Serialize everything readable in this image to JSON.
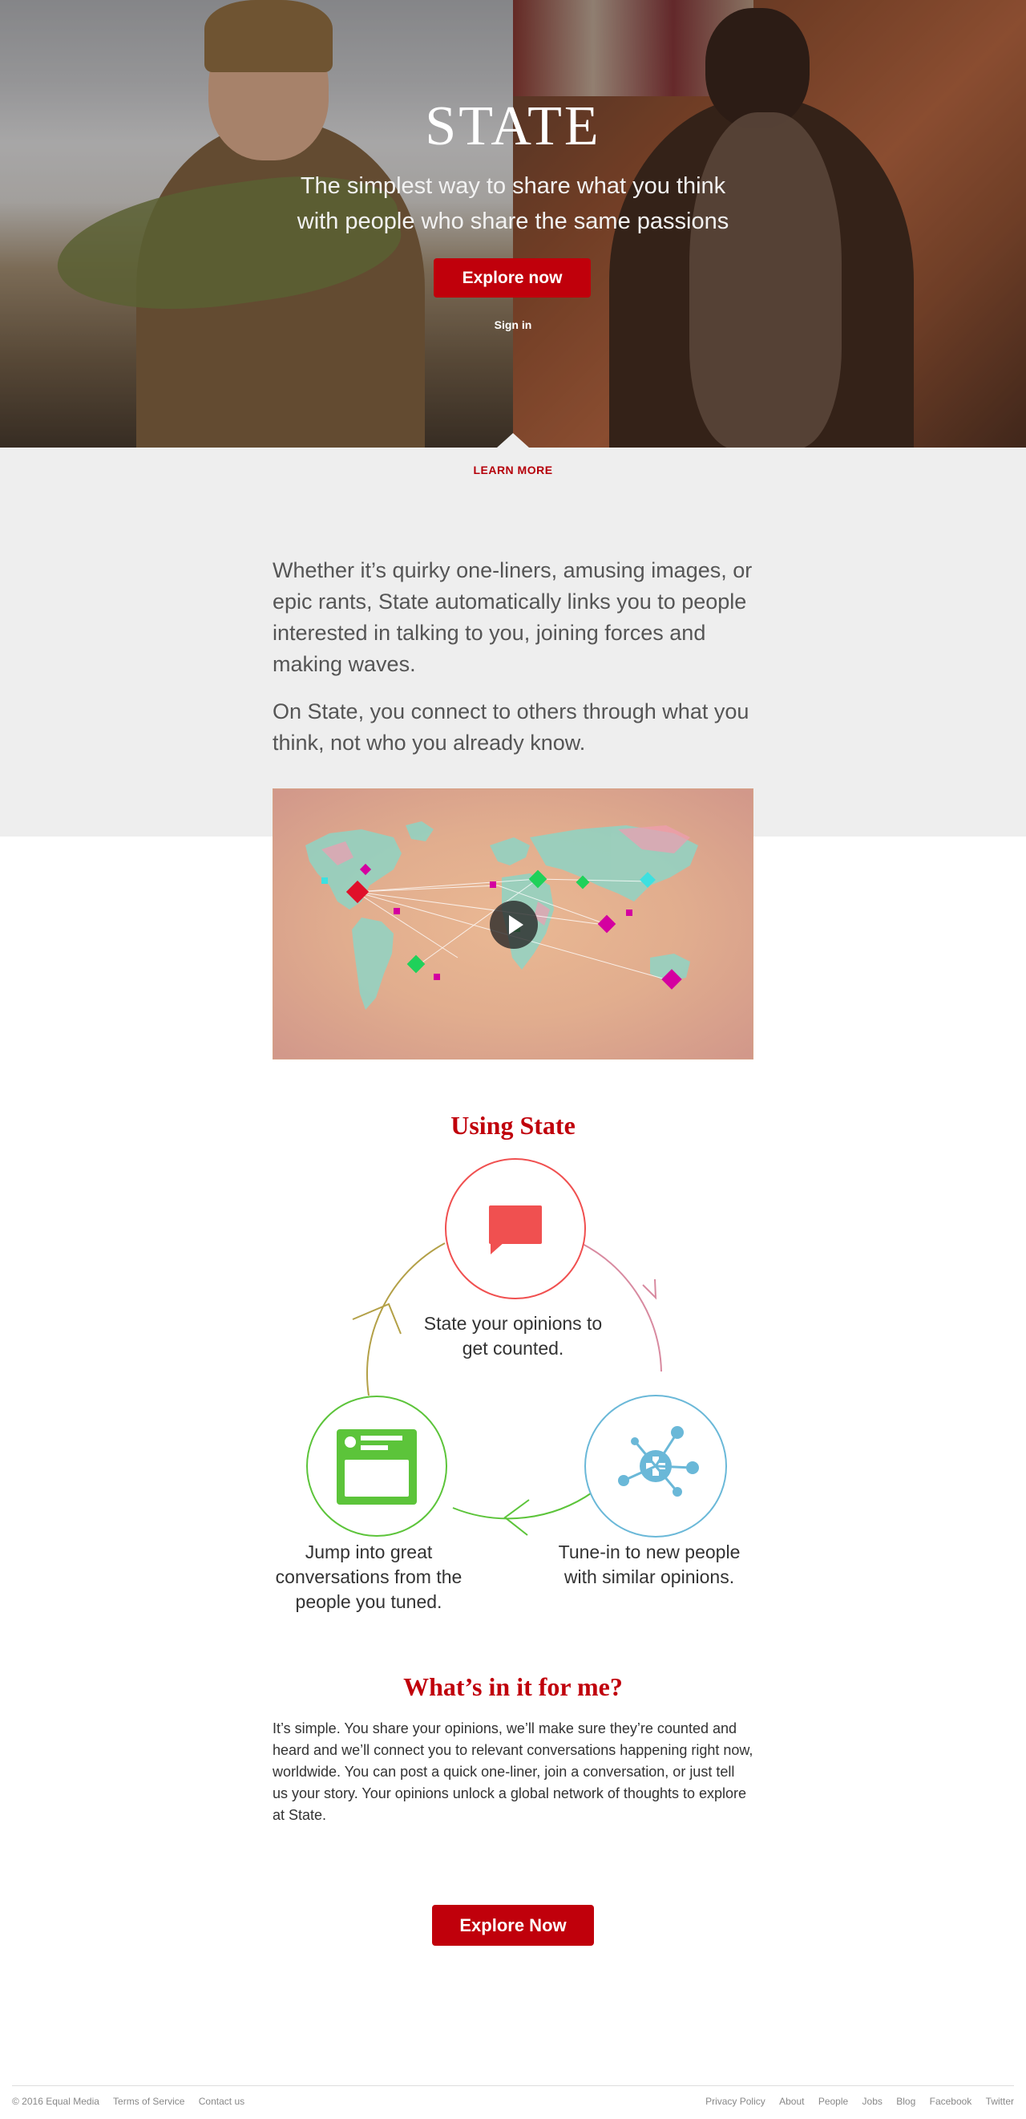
{
  "hero": {
    "logo": "STATE",
    "tagline_line1": "The simplest way to share what you think",
    "tagline_line2": "with people who share the same passions",
    "cta_label": "Explore now",
    "signin_label": "Sign in"
  },
  "intro": {
    "learn_more": "LEARN MORE",
    "paragraph1": "Whether it’s quirky one-liners, amusing images, or epic rants, State automatically links you to people interested in talking to you, joining forces and making waves.",
    "paragraph2": "On State, you connect to others through what you think, not who you already know."
  },
  "using": {
    "title": "Using State",
    "steps": [
      {
        "icon": "speech-bubble-icon",
        "text": "State your opinions to get counted.",
        "color": "#f05050"
      },
      {
        "icon": "network-plus-icon",
        "text": "Tune-in to new people with similar opinions.",
        "color": "#6ab8d8"
      },
      {
        "icon": "feed-card-icon",
        "text": "Jump into great conversations from the people you tuned.",
        "color": "#5cc43a"
      }
    ]
  },
  "whats": {
    "title": "What’s in it for me?",
    "text": "It’s simple. You share your opinions, we’ll make sure they’re counted and heard and we’ll connect you to relevant conversations happening right now, worldwide. You can post a quick one-liner, join a conversation, or just tell us your story. Your opinions unlock a global network of thoughts to explore at State."
  },
  "cta": {
    "label": "Explore Now"
  },
  "footer": {
    "copyright": "© 2016 Equal Media",
    "left_links": [
      "Terms of Service",
      "Contact us"
    ],
    "right_links": [
      "Privacy Policy",
      "About",
      "People",
      "Jobs",
      "Blog",
      "Facebook",
      "Twitter"
    ]
  },
  "colors": {
    "brand_red": "#c0000b",
    "intro_bg": "#eeeeee"
  }
}
